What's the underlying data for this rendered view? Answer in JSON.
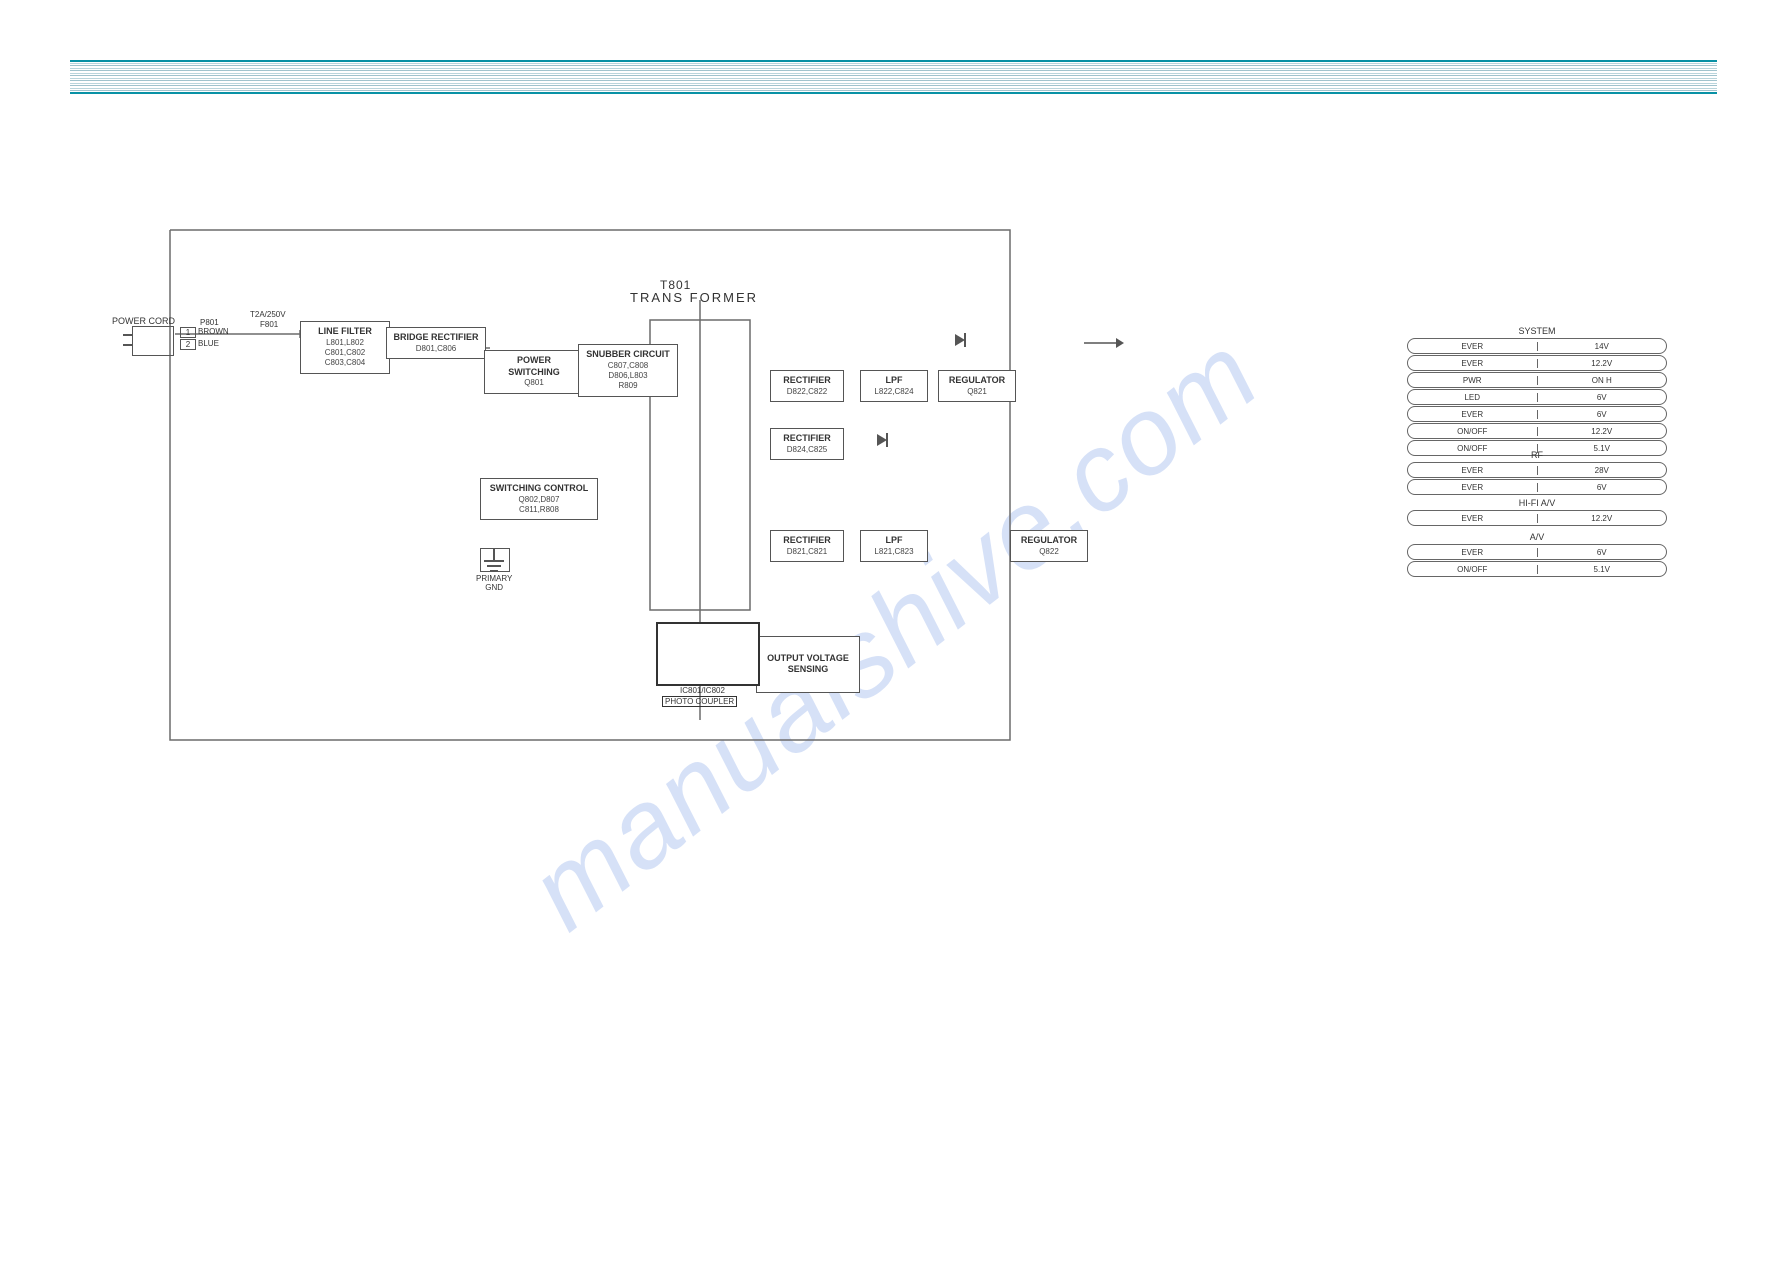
{
  "watermark": "manualshive.com",
  "header": {
    "power_cord": "POWER CORD",
    "cord_pins": [
      "1",
      "2"
    ],
    "cord_colors": [
      "BROWN",
      "BLUE"
    ],
    "fuse_top": "T2A/250V",
    "fuse_ref": "F801",
    "switch_ref": "P801"
  },
  "blocks": {
    "line_filter": {
      "title": "LINE FILTER",
      "sub": "L801,L802\nC801,C802\nC803,C804"
    },
    "bridge": {
      "title": "BRIDGE RECTIFIER",
      "sub": "D801,C806"
    },
    "power_switch": {
      "title": "POWER SWITCHING",
      "sub": "Q801"
    },
    "snubber": {
      "title": "SNUBBER CIRCUIT",
      "sub": "C807,C808\nD806,L803\nR809"
    },
    "switch_ctrl": {
      "title": "SWITCHING CONTROL",
      "sub": "Q802,D807\nC811,R808"
    },
    "transformer": {
      "ref": "T801",
      "title": "TRANS FORMER"
    },
    "rect1": {
      "title": "RECTIFIER",
      "sub": "D822,C822"
    },
    "lpf1": {
      "title": "LPF",
      "sub": "L822,C824"
    },
    "reg1": {
      "title": "REGULATOR",
      "sub": "Q821"
    },
    "rect2": {
      "title": "RECTIFIER",
      "sub": "D824,C825"
    },
    "rect3": {
      "title": "RECTIFIER",
      "sub": "D821,C821"
    },
    "lpf3": {
      "title": "LPF",
      "sub": "L821,C823"
    },
    "reg3": {
      "title": "REGULATOR",
      "sub": "Q822"
    },
    "ovs": {
      "title": "OUTPUT VOLTAGE\nSENSING"
    },
    "primary_gnd": "PRIMARY\nGND",
    "photo": {
      "ref": "IC801/IC802",
      "title": "PHOTO COUPLER"
    }
  },
  "outputs": {
    "system": {
      "head": "SYSTEM",
      "rows": [
        {
          "k": "EVER",
          "v": "14V"
        },
        {
          "k": "EVER",
          "v": "12.2V"
        },
        {
          "k": "PWR",
          "v": "ON H"
        },
        {
          "k": "LED",
          "v": "6V"
        },
        {
          "k": "EVER",
          "v": "6V"
        },
        {
          "k": "ON/OFF",
          "v": "12.2V"
        },
        {
          "k": "ON/OFF",
          "v": "5.1V"
        }
      ]
    },
    "rf": {
      "head": "RF",
      "rows": [
        {
          "k": "EVER",
          "v": "28V"
        },
        {
          "k": "EVER",
          "v": "6V"
        }
      ]
    },
    "hifi": {
      "head": "HI-FI A/V",
      "rows": [
        {
          "k": "EVER",
          "v": "12.2V"
        }
      ]
    },
    "av": {
      "head": "A/V",
      "rows": [
        {
          "k": "EVER",
          "v": "6V"
        },
        {
          "k": "ON/OFF",
          "v": "5.1V"
        }
      ]
    }
  }
}
